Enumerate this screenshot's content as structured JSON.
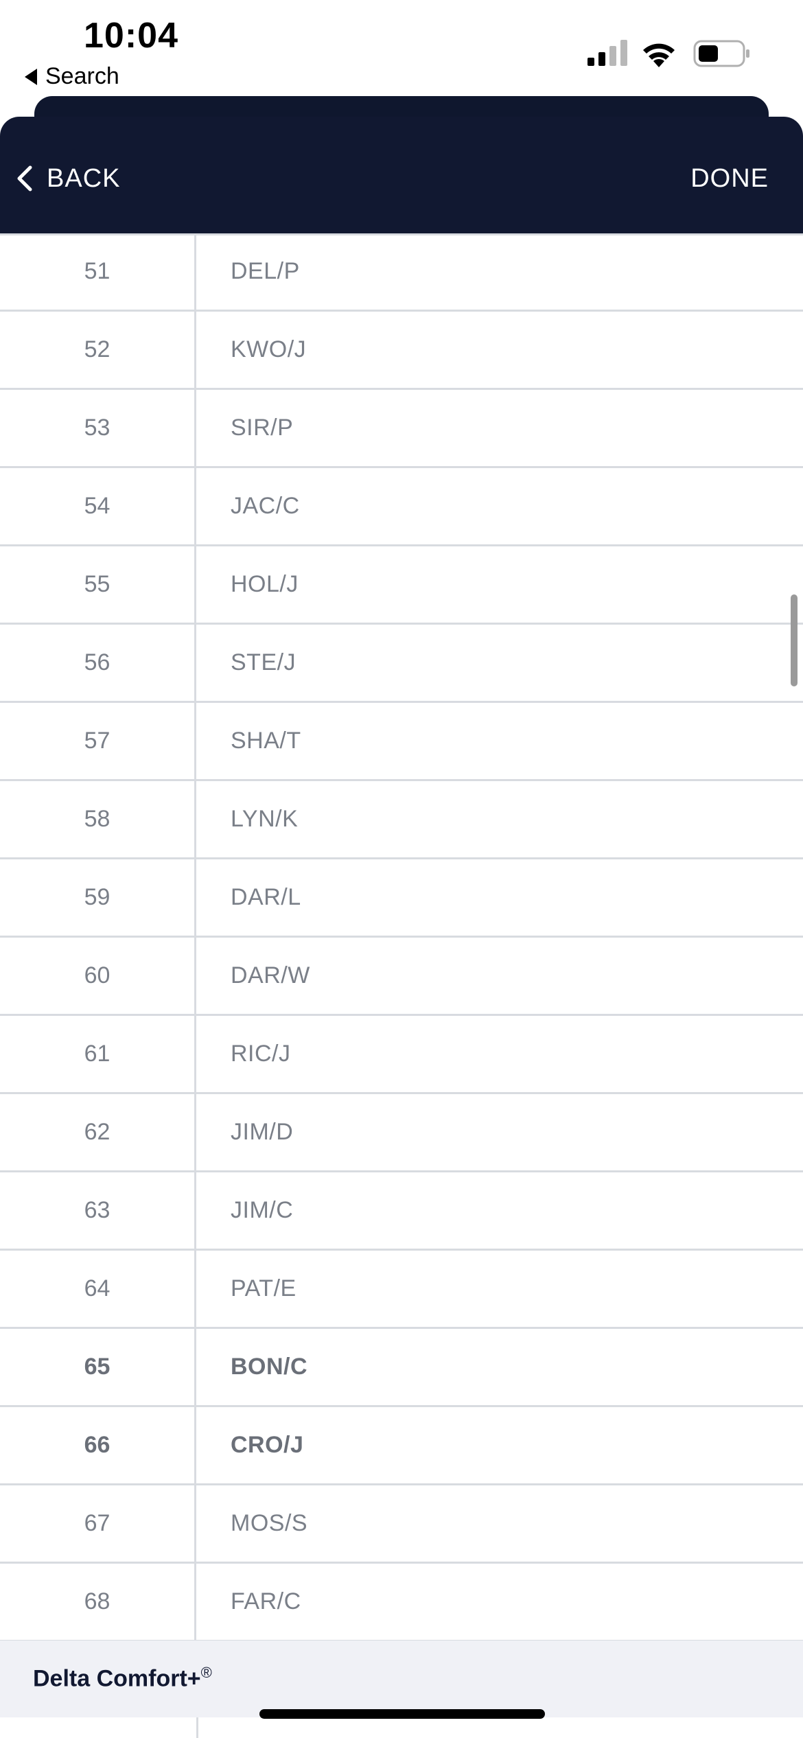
{
  "status_bar": {
    "time": "10:04",
    "back_app_label": "Search"
  },
  "header": {
    "back_label": "BACK",
    "done_label": "DONE"
  },
  "rows": [
    {
      "num": "51",
      "name": "DEL/P",
      "bold": false
    },
    {
      "num": "52",
      "name": "KWO/J",
      "bold": false
    },
    {
      "num": "53",
      "name": "SIR/P",
      "bold": false
    },
    {
      "num": "54",
      "name": "JAC/C",
      "bold": false
    },
    {
      "num": "55",
      "name": "HOL/J",
      "bold": false
    },
    {
      "num": "56",
      "name": "STE/J",
      "bold": false
    },
    {
      "num": "57",
      "name": "SHA/T",
      "bold": false
    },
    {
      "num": "58",
      "name": "LYN/K",
      "bold": false
    },
    {
      "num": "59",
      "name": "DAR/L",
      "bold": false
    },
    {
      "num": "60",
      "name": "DAR/W",
      "bold": false
    },
    {
      "num": "61",
      "name": "RIC/J",
      "bold": false
    },
    {
      "num": "62",
      "name": "JIM/D",
      "bold": false
    },
    {
      "num": "63",
      "name": "JIM/C",
      "bold": false
    },
    {
      "num": "64",
      "name": "PAT/E",
      "bold": false
    },
    {
      "num": "65",
      "name": "BON/C",
      "bold": true
    },
    {
      "num": "66",
      "name": "CRO/J",
      "bold": true
    },
    {
      "num": "67",
      "name": "MOS/S",
      "bold": false
    },
    {
      "num": "68",
      "name": "FAR/C",
      "bold": false
    }
  ],
  "section": {
    "title": "Delta Comfort+",
    "mark": "®"
  },
  "colors": {
    "header_bg": "#111831",
    "text_muted": "#7a7f88",
    "divider": "#d8dbe0",
    "section_bg": "#f0f1f6"
  },
  "icons": {
    "back": "chevron-left-icon",
    "signal": "cellular-signal-icon",
    "wifi": "wifi-icon",
    "battery": "battery-icon"
  }
}
